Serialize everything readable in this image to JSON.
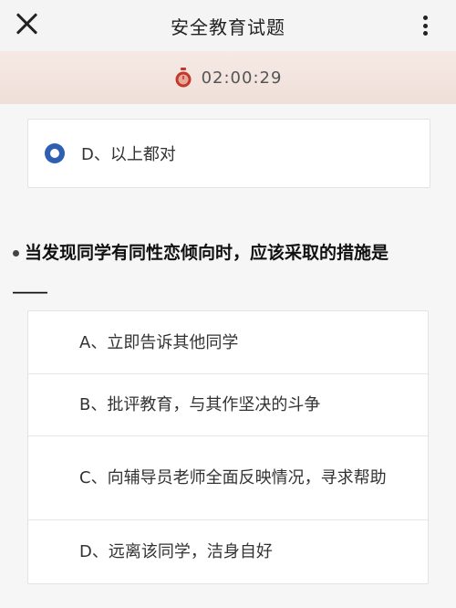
{
  "header": {
    "title": "安全教育试题"
  },
  "timer": {
    "value": "02:00:29"
  },
  "previous_question": {
    "selected_option": "D、以上都对"
  },
  "question": {
    "text": "当发现同学有同性恋倾向时，应该采取的措施是____",
    "options": [
      {
        "label": "A、立即告诉其他同学"
      },
      {
        "label": "B、批评教育，与其作坚决的斗争"
      },
      {
        "label": "C、向辅导员老师全面反映情况，寻求帮助"
      },
      {
        "label": "D、远离该同学，洁身自好"
      }
    ]
  },
  "colors": {
    "selected_radio": "#2f5fb3",
    "timer_bar": "#f3e4de",
    "timer_icon": "#c0392b"
  }
}
